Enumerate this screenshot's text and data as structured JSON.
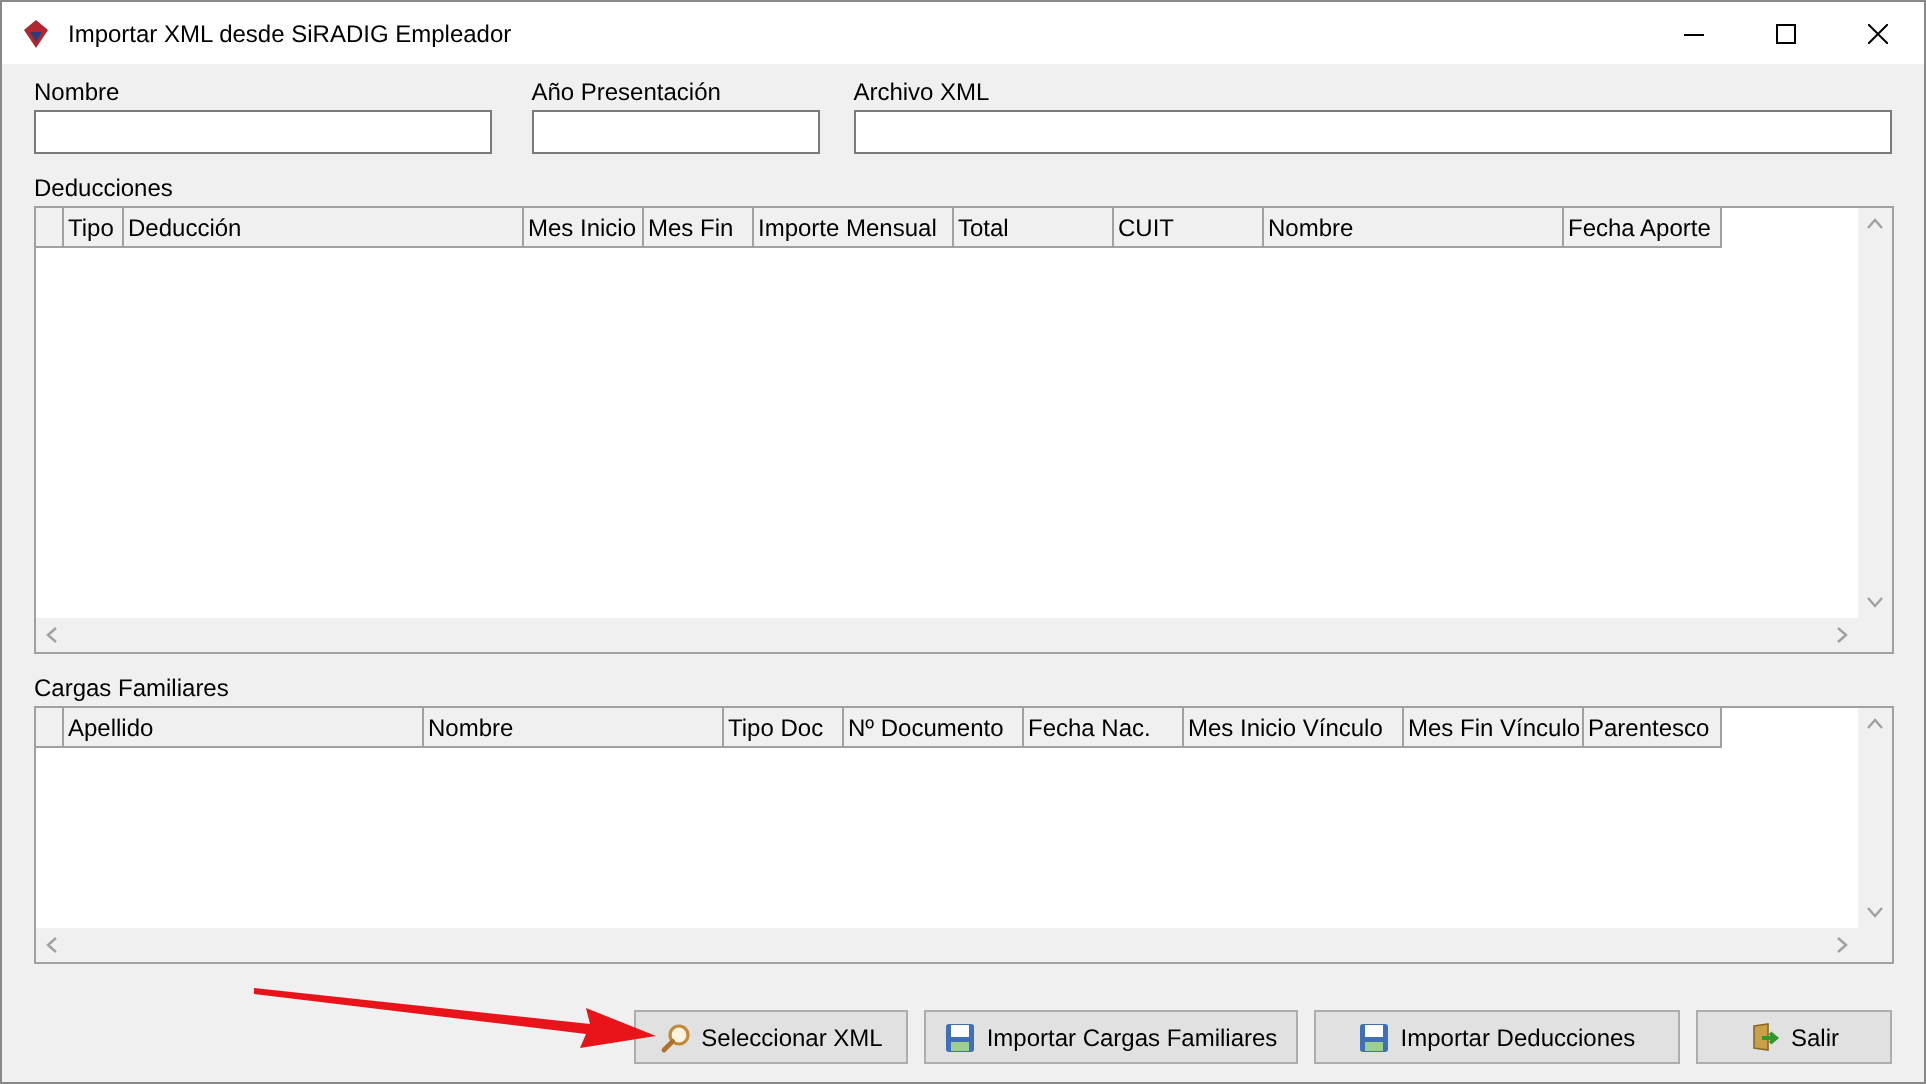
{
  "window": {
    "title": "Importar XML desde SiRADIG Empleador"
  },
  "fields": [
    {
      "label": "Nombre"
    },
    {
      "label": "Año Presentación"
    },
    {
      "label": "Archivo XML"
    }
  ],
  "deducciones": {
    "title": "Deducciones",
    "columns": [
      "Tipo",
      "Deducción",
      "Mes Inicio",
      "Mes Fin",
      "Importe Mensual",
      "Total",
      "CUIT",
      "Nombre",
      "Fecha Aporte"
    ]
  },
  "cargas_familiares": {
    "title": "Cargas Familiares",
    "columns": [
      "Apellido",
      "Nombre",
      "Tipo Doc",
      "Nº Documento",
      "Fecha Nac.",
      "Mes Inicio Vínculo",
      "Mes Fin Vínculo",
      "Parentesco"
    ]
  },
  "buttons": [
    {
      "label": "Seleccionar XML",
      "kind": "search"
    },
    {
      "label": "Importar Cargas Familiares",
      "kind": "save"
    },
    {
      "label": "Importar Deducciones",
      "kind": "save"
    },
    {
      "label": "Salir",
      "kind": "exit"
    }
  ]
}
